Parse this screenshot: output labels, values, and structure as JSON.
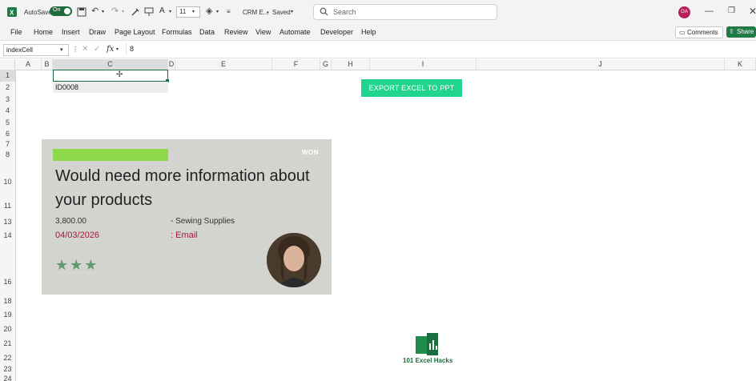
{
  "titlebar": {
    "autosave_label": "AutoSave",
    "autosave_state": "On",
    "font_size": "11",
    "file_name": "CRM E...",
    "save_status": "Saved",
    "search_placeholder": "Search",
    "user_initials": "OA"
  },
  "ribbon": {
    "tabs": [
      "File",
      "Home",
      "Insert",
      "Draw",
      "Page Layout",
      "Formulas",
      "Data",
      "Review",
      "View",
      "Automate",
      "Developer",
      "Help"
    ],
    "comments_label": "Comments",
    "share_label": "Share"
  },
  "formula_bar": {
    "name_box": "indexCell",
    "fx": "fx",
    "value": "8"
  },
  "grid": {
    "columns": [
      "A",
      "B",
      "C",
      "D",
      "E",
      "F",
      "G",
      "H",
      "I",
      "J",
      "K"
    ],
    "rows": [
      "1",
      "2",
      "3",
      "4",
      "5",
      "6",
      "7",
      "8",
      "10",
      "11",
      "13",
      "14",
      "16",
      "18",
      "19",
      "20",
      "21",
      "22",
      "23",
      "24"
    ],
    "c2_value": "ID0008"
  },
  "export_button": "EXPORT EXCEL TO PPT",
  "card": {
    "status": "WON",
    "headline": "Would need more information about your products",
    "amount": "3,800.00",
    "category": "-  Sewing Supplies",
    "date": "04/03/2026",
    "channel": ":  Email",
    "rating": "★★★"
  },
  "logo_text": "101 Excel Hacks",
  "colors": {
    "excel_green": "#1f7a45",
    "export_button": "#21d58f",
    "card_bar": "#8ed94b",
    "date_red": "#a31e38",
    "star_green": "#5e9a70"
  }
}
